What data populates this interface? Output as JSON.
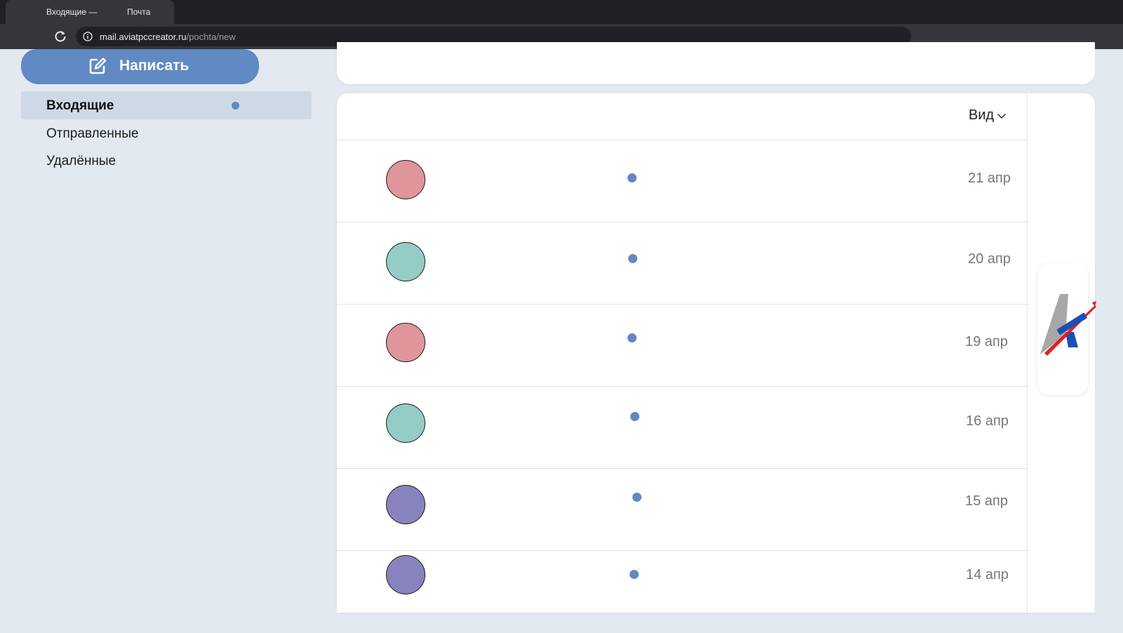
{
  "browser": {
    "tab_title": "Входящие —",
    "tab_subtitle": "Почта",
    "url_host": "mail.aviatpccreator.ru",
    "url_path": "/pochta/new"
  },
  "sidebar": {
    "compose_label": "Написать",
    "items": [
      {
        "label": "Входящие",
        "active": true,
        "unread": true
      },
      {
        "label": "Отправленные",
        "active": false
      },
      {
        "label": "Удалённые",
        "active": false
      }
    ]
  },
  "list": {
    "view_label": "Вид",
    "messages": [
      {
        "avatar_color": "#e0959a",
        "unread": true,
        "date": "21 апр"
      },
      {
        "avatar_color": "#95ccc5",
        "unread": true,
        "date": "20 апр"
      },
      {
        "avatar_color": "#e0959a",
        "unread": true,
        "date": "19 апр"
      },
      {
        "avatar_color": "#95ccc5",
        "unread": true,
        "date": "16 апр"
      },
      {
        "avatar_color": "#8983bd",
        "unread": true,
        "date": "15 апр"
      },
      {
        "avatar_color": "#8983bd",
        "unread": true,
        "date": "14 апр"
      }
    ]
  },
  "colors": {
    "accent": "#6189c3",
    "background": "#e3e9f1",
    "active_item": "#cfd9e6"
  }
}
